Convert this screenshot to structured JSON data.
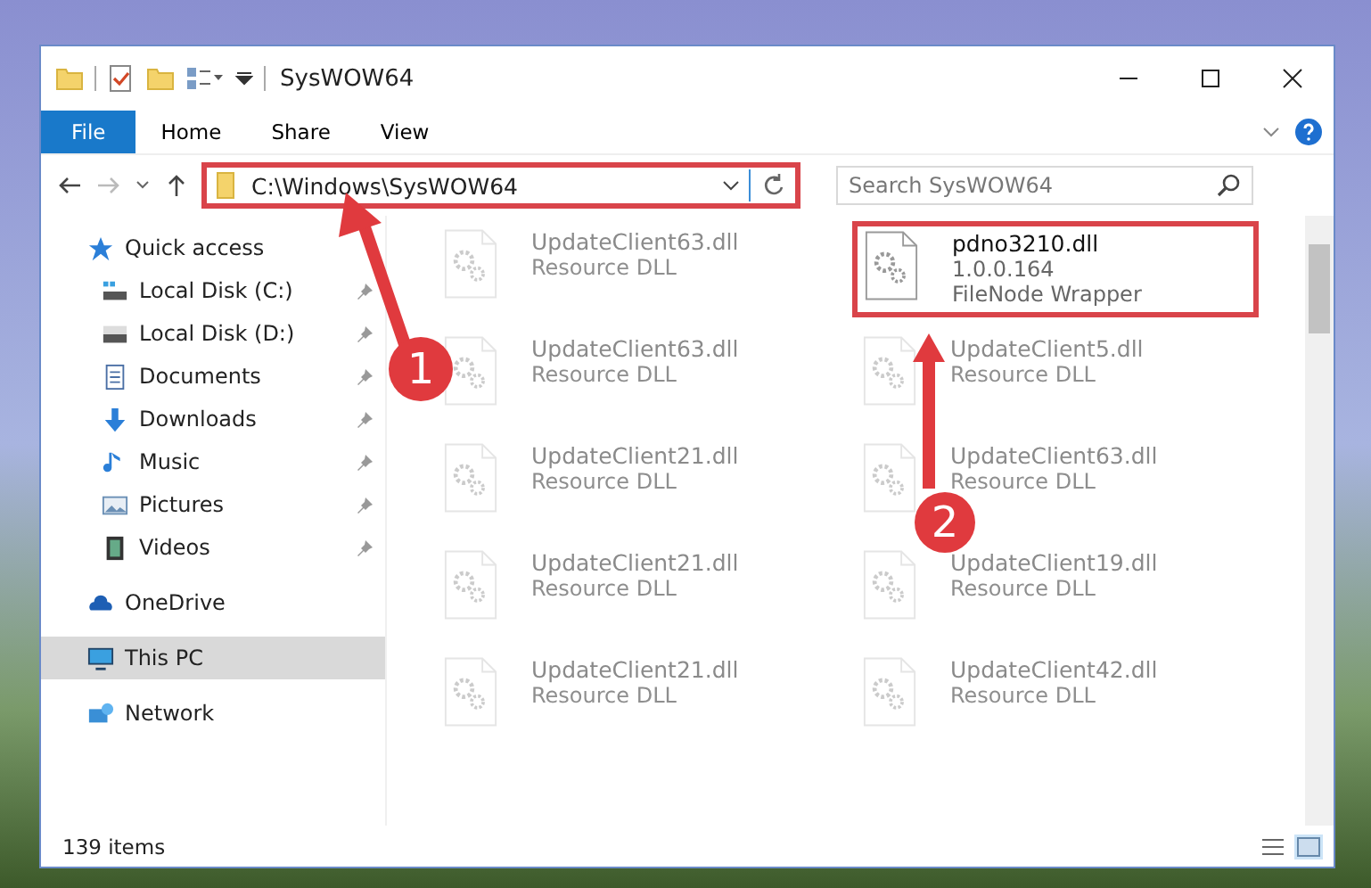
{
  "window": {
    "title": "SysWOW64"
  },
  "ribbon_tabs": [
    {
      "label": "File",
      "kind": "file",
      "selected": false
    },
    {
      "label": "Home",
      "kind": "tab",
      "selected": false
    },
    {
      "label": "Share",
      "kind": "tab",
      "selected": false
    },
    {
      "label": "View",
      "kind": "tab",
      "selected": false
    }
  ],
  "address_bar": {
    "path": "C:\\Windows\\SysWOW64",
    "callout": "1"
  },
  "search": {
    "placeholder": "Search SysWOW64"
  },
  "sidebar": {
    "items": [
      {
        "label": "Quick access",
        "selected": false,
        "children": [
          {
            "label": "Local Disk (C:)",
            "pinned": true,
            "selected": false
          },
          {
            "label": "Local Disk (D:)",
            "pinned": true,
            "selected": false
          },
          {
            "label": "Documents",
            "pinned": true,
            "selected": false
          },
          {
            "label": "Downloads",
            "pinned": true,
            "selected": false
          },
          {
            "label": "Music",
            "pinned": true,
            "selected": false
          },
          {
            "label": "Pictures",
            "pinned": true,
            "selected": false
          },
          {
            "label": "Videos",
            "pinned": true,
            "selected": false
          }
        ]
      },
      {
        "label": "OneDrive",
        "selected": false
      },
      {
        "label": "This PC",
        "selected": true
      },
      {
        "label": "Network",
        "selected": false
      }
    ]
  },
  "files": [
    {
      "name": "UpdateClient63.dll",
      "details": [
        "Resource DLL"
      ],
      "blurred": true
    },
    {
      "name": "pdno3210.dll",
      "details": [
        "1.0.0.164",
        "FileNode Wrapper"
      ],
      "blurred": false,
      "callout": "2"
    },
    {
      "name": "UpdateClient63.dll",
      "details": [
        "Resource DLL"
      ],
      "blurred": true
    },
    {
      "name": "UpdateClient5.dll",
      "details": [
        "Resource DLL"
      ],
      "blurred": true
    },
    {
      "name": "UpdateClient21.dll",
      "details": [
        "Resource DLL"
      ],
      "blurred": true
    },
    {
      "name": "UpdateClient63.dll",
      "details": [
        "Resource DLL"
      ],
      "blurred": true
    },
    {
      "name": "UpdateClient21.dll",
      "details": [
        "Resource DLL"
      ],
      "blurred": true
    },
    {
      "name": "UpdateClient19.dll",
      "details": [
        "Resource DLL"
      ],
      "blurred": true
    },
    {
      "name": "UpdateClient21.dll",
      "details": [
        "Resource DLL"
      ],
      "blurred": true
    },
    {
      "name": "UpdateClient42.dll",
      "details": [
        "Resource DLL"
      ],
      "blurred": true
    }
  ],
  "status_bar": {
    "count": "139 items"
  }
}
